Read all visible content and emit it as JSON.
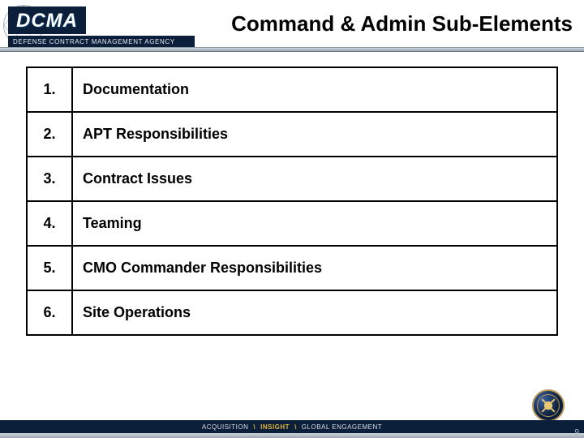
{
  "header": {
    "logo_text": "DCMA",
    "agency_line": "DEFENSE CONTRACT MANAGEMENT AGENCY",
    "slide_title": "Command & Admin Sub-Elements"
  },
  "table": {
    "rows": [
      {
        "num": "1.",
        "label": "Documentation"
      },
      {
        "num": "2.",
        "label": "APT Responsibilities"
      },
      {
        "num": "3.",
        "label": "Contract Issues"
      },
      {
        "num": "4.",
        "label": "Teaming"
      },
      {
        "num": "5.",
        "label": "CMO Commander Responsibilities"
      },
      {
        "num": "6.",
        "label": "Site Operations"
      }
    ]
  },
  "footer": {
    "word1": "ACQUISITION",
    "word2": "INSIGHT",
    "word3": "GLOBAL ENGAGEMENT",
    "sep": "\\"
  },
  "page_number": "9"
}
